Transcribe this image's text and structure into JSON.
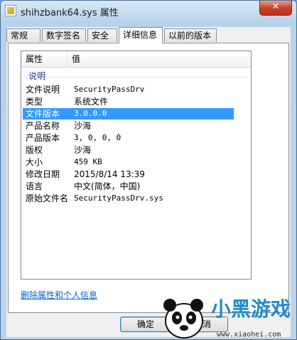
{
  "window": {
    "title": "shihzbank64.sys 属性",
    "close_label": "✕"
  },
  "tabs": [
    {
      "label": "常规"
    },
    {
      "label": "数字签名"
    },
    {
      "label": "安全"
    },
    {
      "label": "详细信息"
    },
    {
      "label": "以前的版本"
    }
  ],
  "listview": {
    "headers": [
      "属性",
      "值"
    ],
    "group_label": "说明",
    "rows": [
      {
        "key": "文件说明",
        "value": "SecurityPassDrv"
      },
      {
        "key": "类型",
        "value": "系统文件"
      },
      {
        "key": "文件版本",
        "value": "3.0.0.0"
      },
      {
        "key": "产品名称",
        "value": "沙海"
      },
      {
        "key": "产品版本",
        "value": "3, 0, 0, 0"
      },
      {
        "key": "版权",
        "value": "沙海"
      },
      {
        "key": "大小",
        "value": "459 KB"
      },
      {
        "key": "修改日期",
        "value": "2015/8/14 13:39"
      },
      {
        "key": "语言",
        "value": "中文(简体，中国)"
      },
      {
        "key": "原始文件名",
        "value": "SecurityPassDrv.sys"
      }
    ],
    "selected_row": "文件版本"
  },
  "link": {
    "label": "删除属性和个人信息"
  },
  "buttons": {
    "ok": "确定",
    "cancel": "取消"
  },
  "watermark": {
    "brand": "小黑游戏",
    "url": "www.xiaohei.com"
  },
  "colors": {
    "selection": "#3399ff",
    "link": "#0066cc",
    "close": "#c7432a"
  }
}
